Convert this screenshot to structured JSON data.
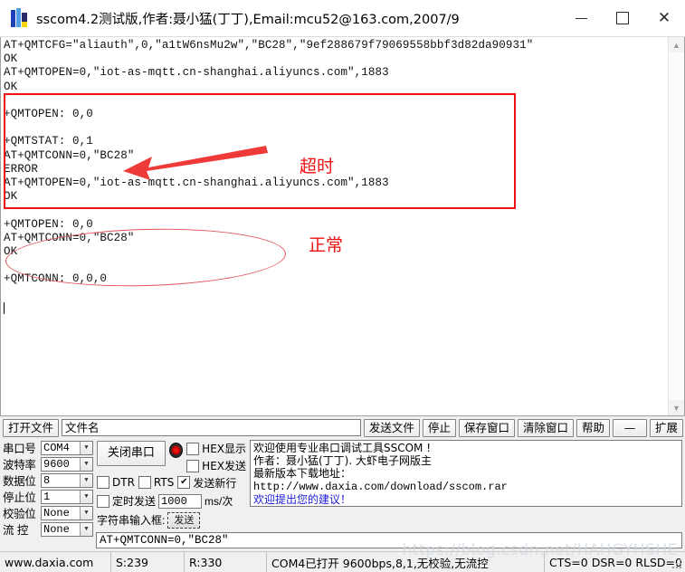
{
  "window": {
    "title": "sscom4.2测试版,作者:聂小猛(丁丁),Email:mcu52@163.com,2007/9",
    "icon": "sscom-app-icon",
    "minimize_label": "—",
    "maximize_label": "□",
    "close_label": "✕"
  },
  "terminal": {
    "content": "AT+QMTCFG=\"aliauth\",0,\"a1tW6nsMu2w\",\"BC28\",\"9ef288679f79069558bbf3d82da90931\"\nOK\nAT+QMTOPEN=0,\"iot-as-mqtt.cn-shanghai.aliyuncs.com\",1883\nOK\n\n+QMTOPEN: 0,0\n\n+QMTSTAT: 0,1\nAT+QMTCONN=0,\"BC28\"\nERROR\nAT+QMTOPEN=0,\"iot-as-mqtt.cn-shanghai.aliyuncs.com\",1883\nOK\n\n+QMTOPEN: 0,0\nAT+QMTCONN=0,\"BC28\"\nOK\n\n+QMTCONN: 0,0,0",
    "scrollbar": {
      "up_arrow": "⌃",
      "down_arrow": "⌄"
    }
  },
  "annotations": {
    "timeout_label": "超时",
    "normal_label": "正常",
    "box_color": "#f01010",
    "ellipse_color": "#e0525c",
    "arrow_color": "#ef3a3a"
  },
  "file_toolbar": {
    "open_file": "打开文件",
    "filename_value": "文件名",
    "send_file": "发送文件",
    "stop": "停止",
    "save_window": "保存窗口",
    "clear_window": "清除窗口",
    "help": "帮助",
    "dash": "—",
    "extend": "扩展"
  },
  "port_settings": {
    "rows": [
      {
        "label": "串口号",
        "value": "COM4"
      },
      {
        "label": "波特率",
        "value": "9600"
      },
      {
        "label": "数据位",
        "value": "8"
      },
      {
        "label": "停止位",
        "value": "1"
      },
      {
        "label": "校验位",
        "value": "None"
      },
      {
        "label": "流 控",
        "value": "None"
      }
    ],
    "dropdown_arrow": "▼"
  },
  "controls": {
    "close_port_button": "关闭串口",
    "led_name": "port-status-led",
    "hex_display": {
      "label": "HEX显示",
      "checked": false
    },
    "hex_send": {
      "label": "HEX发送",
      "checked": false
    },
    "dtr": {
      "label": "DTR",
      "checked": false
    },
    "rts": {
      "label": "RTS",
      "checked": false
    },
    "send_newline": {
      "label": "发送新行",
      "checked": true,
      "mark": "✔"
    },
    "timed_send": {
      "label": "定时发送",
      "checked": false
    },
    "interval_value": "1000",
    "interval_unit": "ms/次",
    "string_input_label": "字符串输入框:",
    "send_button": "发送"
  },
  "info_panel": {
    "line1": "欢迎使用专业串口调试工具SSCOM !",
    "line2": "作者：聂小猛(丁丁). 大虾电子网版主",
    "line3": "最新版本下载地址：",
    "line4": "http://www.daxia.com/download/sscom.rar",
    "line5": "欢迎提出您的建议！"
  },
  "send_area": {
    "value": "AT+QMTCONN=0,\"BC28\""
  },
  "status_bar": {
    "site": "www.daxia.com",
    "sent": "S:239",
    "received": "R:330",
    "port_status": "COM4已打开  9600bps,8,1,无校验,无流控",
    "signals": "CTS=0 DSR=0 RLSD=0"
  },
  "watermark": {
    "text": "https://blog.csdn.net/HAHGYHSHE"
  }
}
